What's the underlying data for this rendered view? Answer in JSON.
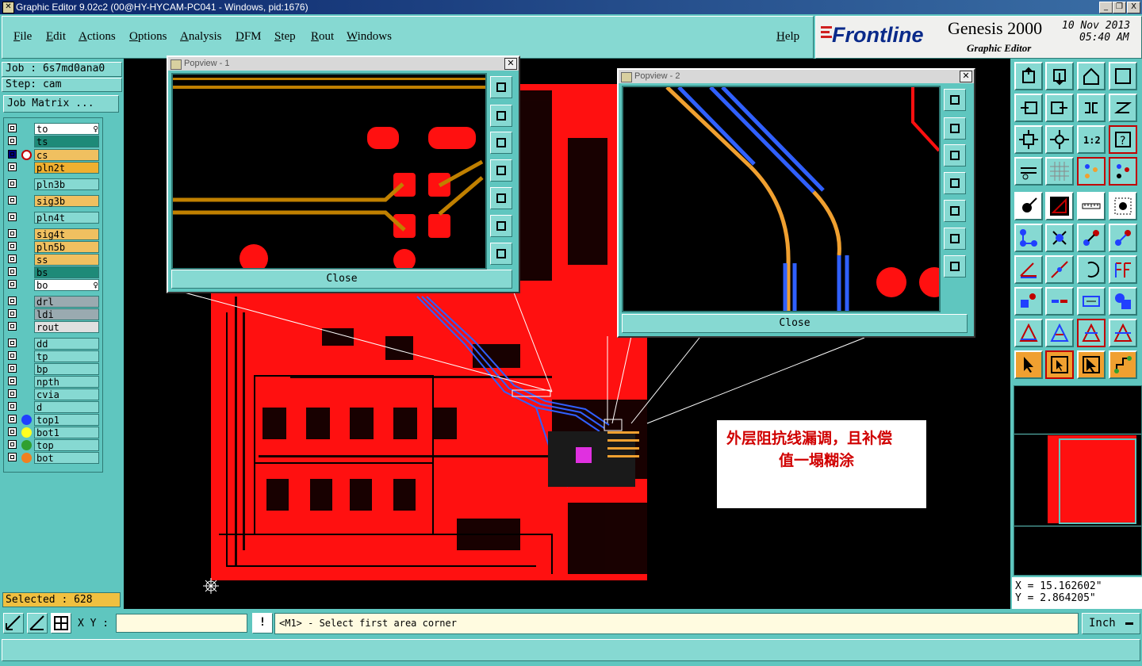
{
  "window": {
    "title": "Graphic Editor 9.02c2 (00@HY-HYCAM-PC041 - Windows, pid:1676)",
    "controls": [
      "_",
      "❐",
      "X"
    ]
  },
  "menu": [
    "File",
    "Edit",
    "Actions",
    "Options",
    "Analysis",
    "DFM",
    "Step",
    "Rout",
    "Windows"
  ],
  "help_label": "Help",
  "brand": {
    "logo": "Frontline",
    "product": "Genesis 2000",
    "subtitle": "Graphic Editor",
    "date": "10 Nov 2013",
    "time": "05:40 AM"
  },
  "job": {
    "job_label": "Job : 6s7md0ana0",
    "step_label": "Step: cam",
    "matrix_button": "Job Matrix ..."
  },
  "layers": [
    {
      "name": "to",
      "color": "#ffffff",
      "marker": "♀"
    },
    {
      "name": "ts",
      "color": "#1e8a78"
    },
    {
      "name": "cs",
      "color": "#f0c060",
      "active": true
    },
    {
      "name": "pln2t",
      "color": "#f0b030"
    },
    {
      "name": "pln3b",
      "color": "#86d9d2"
    },
    {
      "name": "sig3b",
      "color": "#f0c060"
    },
    {
      "name": "pln4t",
      "color": "#86d9d2"
    },
    {
      "name": "sig4t",
      "color": "#f0c060"
    },
    {
      "name": "pln5b",
      "color": "#f0c060"
    },
    {
      "name": "ss",
      "color": "#f0c060"
    },
    {
      "name": "bs",
      "color": "#1e8a78"
    },
    {
      "name": "bo",
      "color": "#ffffff",
      "marker": "♀"
    },
    {
      "name": "drl",
      "color": "#9aaab0"
    },
    {
      "name": "ldi",
      "color": "#9aaab0"
    },
    {
      "name": "rout",
      "color": "#e0e0e0"
    },
    {
      "name": "dd",
      "color": "#86d9d2"
    },
    {
      "name": "tp",
      "color": "#86d9d2"
    },
    {
      "name": "bp",
      "color": "#86d9d2"
    },
    {
      "name": "npth",
      "color": "#86d9d2"
    },
    {
      "name": "cvia",
      "color": "#86d9d2"
    },
    {
      "name": "d",
      "color": "#86d9d2"
    },
    {
      "name": "top1",
      "color": "#86d9d2",
      "dot": "#2040ff"
    },
    {
      "name": "bot1",
      "color": "#86d9d2",
      "dot": "#ffff20"
    },
    {
      "name": "top",
      "color": "#86d9d2",
      "dot": "#30a030"
    },
    {
      "name": "bot",
      "color": "#86d9d2",
      "dot": "#f08020"
    }
  ],
  "popview1": {
    "title": "Popview - 1",
    "close_label": "Close"
  },
  "popview2": {
    "title": "Popview - 2",
    "close_label": "Close"
  },
  "annotation": {
    "line1": "外层阻抗线漏调，且补偿",
    "line2": "值一塌糊涂"
  },
  "coords": {
    "x": "X = 15.162602\"",
    "y": "Y = 2.864205\""
  },
  "selected": "Selected : 628",
  "xy_label": "X Y :",
  "prompt": "<M1> - Select first area corner",
  "units": "Inch"
}
